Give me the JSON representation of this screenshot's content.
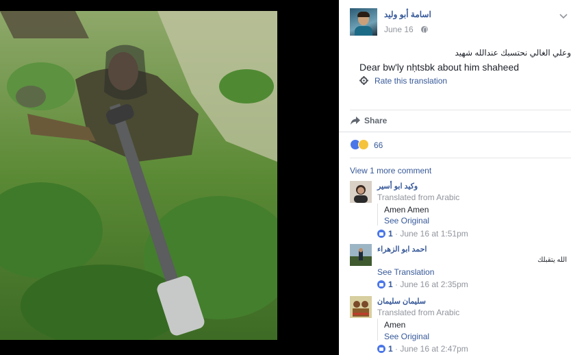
{
  "post": {
    "author": "اسامة أبو وليد",
    "date": "June 16",
    "text_ar": "وعلي الغالي نحتسبك عندالله شهيد",
    "translation": "Dear bw'ly nḥtsbk about him shaheed",
    "rate_translation": "Rate this translation",
    "share_label": "Share",
    "reaction_count": "66",
    "view_more_comments": "View 1 more comment"
  },
  "comments": [
    {
      "name": "وكيد ابو أسير",
      "translated_from": "Translated from Arabic",
      "text": "Amen Amen",
      "see_original": "See Original",
      "likes": "1",
      "time": "· June 16 at 1:51pm"
    },
    {
      "name": "احمد ابو الزهراء",
      "text_ar": "الله يتقبلك",
      "see_translation": "See Translation",
      "likes": "1",
      "time": "· June 16 at 2:35pm"
    },
    {
      "name": "سليمان سليمان",
      "translated_from": "Translated from Arabic",
      "text": "Amen",
      "see_original": "See Original",
      "likes": "1",
      "time": "· June 16 at 2:47pm"
    }
  ],
  "colors": {
    "link": "#365899",
    "meta": "#90949c",
    "like_blue": "#4a76e8"
  },
  "icons": [
    "chevron-down-icon",
    "globe-icon",
    "gear-icon",
    "share-icon",
    "like-icon",
    "sad-icon"
  ]
}
